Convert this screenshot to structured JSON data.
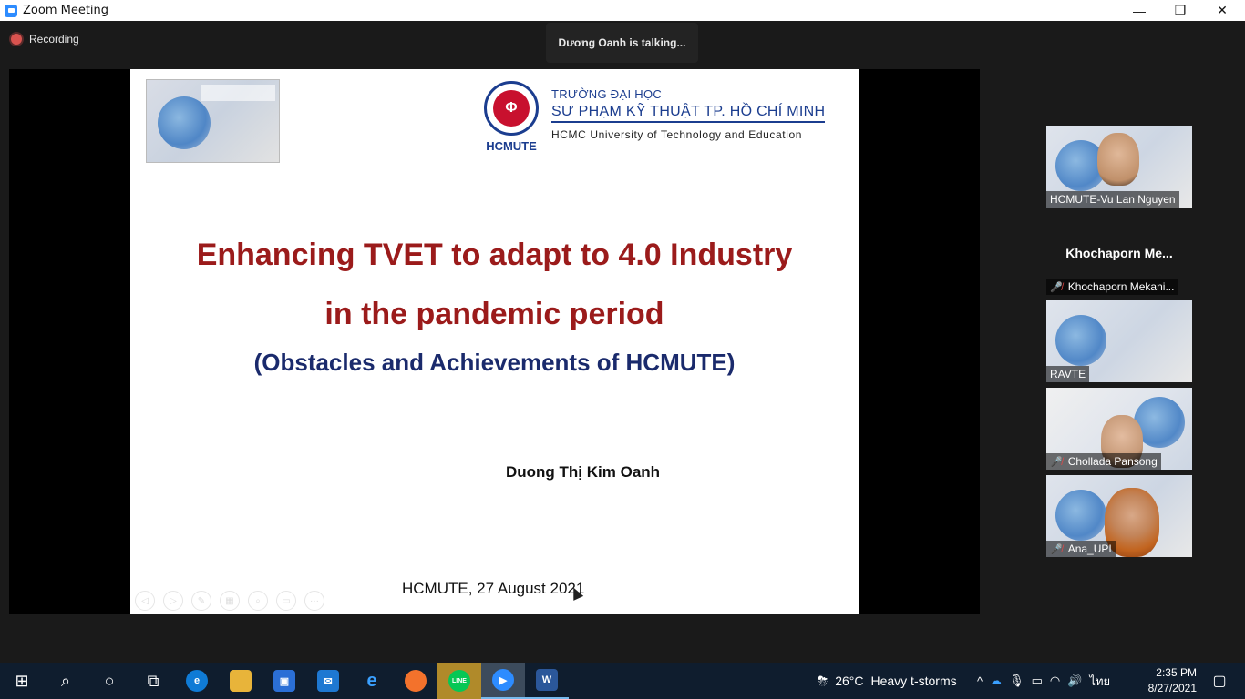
{
  "window": {
    "title": "Zoom Meeting",
    "minimize_glyph": "—",
    "maximize_glyph": "❐",
    "close_glyph": "✕"
  },
  "meeting": {
    "recording_label": "Recording",
    "talking_indicator": "Dương Oanh is talking..."
  },
  "slide": {
    "university_line1": "TRƯỜNG ĐẠI HỌC",
    "university_line2": "SƯ PHẠM KỸ THUẬT TP. HỒ CHÍ MINH",
    "university_line3": "HCMC University of Technology and Education",
    "logo_text": "HCMUTE",
    "title_line1": "Enhancing TVET to adapt to 4.0 Industry",
    "title_line2": "in the pandemic period",
    "subtitle": "(Obstacles and Achievements of HCMUTE)",
    "author": "Duong Thị Kim Oanh",
    "footer": "HCMUTE, 27 August 2021"
  },
  "participants": [
    {
      "name": "HCMUTE-Vu Lan Nguyen",
      "muted": false,
      "video": true
    },
    {
      "name": "Khochaporn Mekani...",
      "display_name": "Khochaporn  Me...",
      "muted": true,
      "video": false
    },
    {
      "name": "RAVTE",
      "muted": false,
      "video": true
    },
    {
      "name": "Chollada Pansong",
      "muted": true,
      "video": true
    },
    {
      "name": "Ana_UPI",
      "muted": true,
      "video": true
    }
  ],
  "taskbar": {
    "weather_temp": "26°C",
    "weather_desc": "Heavy t-storms",
    "language": "ไทย",
    "time": "2:35 PM",
    "date": "8/27/2021",
    "apps": [
      "start-icon",
      "search-icon",
      "cortana-icon",
      "task-view-icon",
      "edge-icon",
      "file-explorer-icon",
      "store-icon",
      "mail-icon",
      "ie-icon",
      "firefox-icon",
      "line-icon",
      "zoom-icon",
      "word-icon"
    ]
  },
  "colors": {
    "title_red": "#9b1b1b",
    "subtitle_navy": "#1a2a6c",
    "uni_blue": "#1b3d8f",
    "taskbar_bg": "#0f1d2e",
    "zoom_blue": "#2d8cff"
  }
}
